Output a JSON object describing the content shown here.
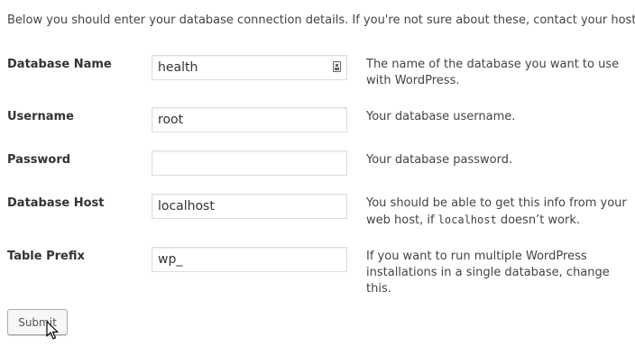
{
  "intro": "Below you should enter your database connection details. If you're not sure about these, contact your host.",
  "fields": [
    {
      "label": "Database Name",
      "value": "health",
      "placeholder": "",
      "description": "The name of the database you want to use with WordPress."
    },
    {
      "label": "Username",
      "value": "root",
      "placeholder": "",
      "description": "Your database username."
    },
    {
      "label": "Password",
      "value": "",
      "placeholder": "",
      "description": "Your database password."
    },
    {
      "label": "Database Host",
      "value": "localhost",
      "placeholder": "",
      "description_before": "You should be able to get this info from your web host, if",
      "description_code": "localhost",
      "description_after": "doesn’t work."
    },
    {
      "label": "Table Prefix",
      "value": "wp_",
      "placeholder": "",
      "description": "If you want to run multiple WordPress installations in a single database, change this."
    }
  ],
  "submit_label": "Submit",
  "icons": {
    "keyboard": "keyboard-icon",
    "cursor": "mouse-pointer-icon"
  },
  "colors": {
    "text": "#444444",
    "label": "#333333",
    "input_border": "#dddddd",
    "button_border": "#aaaaaa",
    "button_bg": "#f7f7f7"
  }
}
